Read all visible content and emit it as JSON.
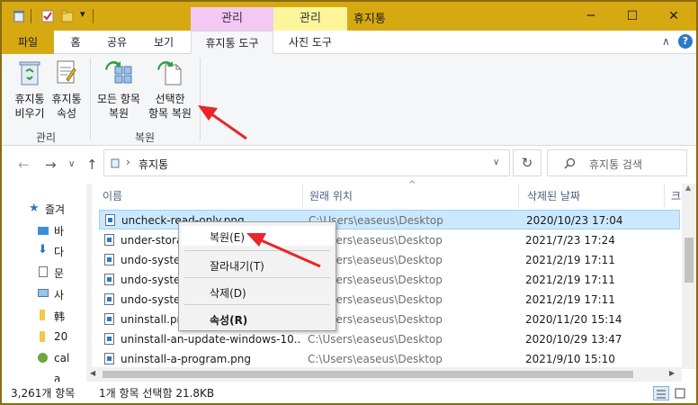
{
  "titlebar": {
    "title": "휴지통",
    "ctx_tab_manage_1": "관리",
    "ctx_tab_manage_2": "관리",
    "minimize_glyph": "─",
    "maximize_glyph": "☐",
    "close_glyph": "✕",
    "qa_dropdown_glyph": "▾"
  },
  "tabs": {
    "file": "파일",
    "home": "홈",
    "share": "공유",
    "view": "보기",
    "recycle_tools": "휴지통 도구",
    "picture_tools": "사진 도구",
    "collapse_glyph": "∧",
    "help_glyph": "?"
  },
  "ribbon": {
    "empty_bin_l1": "휴지통",
    "empty_bin_l2": "비우기",
    "props_l1": "휴지통",
    "props_l2": "속성",
    "group_manage": "관리",
    "restore_all_l1": "모든 항목",
    "restore_all_l2": "복원",
    "restore_sel_l1": "선택한",
    "restore_sel_l2": "항목 복원",
    "group_restore": "복원"
  },
  "nav": {
    "back_glyph": "←",
    "forward_glyph": "→",
    "recent_glyph": "∨",
    "up_glyph": "↑",
    "breadcrumb_sep": "›",
    "location": "휴지통",
    "addr_dropdown_glyph": "∨",
    "refresh_glyph": "↻",
    "search_placeholder": "휴지통 검색"
  },
  "navpane": {
    "items": [
      "즐겨",
      "바",
      "다",
      "문",
      "사",
      "韩",
      "20",
      "cal",
      "a"
    ]
  },
  "columns": {
    "name": "이름",
    "origin": "원래 위치",
    "deleted": "삭제된 날짜",
    "size": "크",
    "sort_glyph": "^"
  },
  "files": [
    {
      "name": "uncheck-read-only.png",
      "origin": "C:\\Users\\easeus\\Desktop",
      "deleted": "2020/10/23 17:04"
    },
    {
      "name": "under-storage-sense.png",
      "origin": "C:\\Users\\easeus\\Desktop",
      "deleted": "2021/7/23 17:24"
    },
    {
      "name": "undo-system-restore-1.png",
      "origin": "C:\\Users\\easeus\\Desktop",
      "deleted": "2021/2/19 17:11"
    },
    {
      "name": "undo-system-restore-2.png",
      "origin": "C:\\Users\\easeus\\Desktop",
      "deleted": "2021/2/19 17:11"
    },
    {
      "name": "undo-system-restore-3.png",
      "origin": "C:\\Users\\easeus\\Desktop",
      "deleted": "2021/2/19 17:11"
    },
    {
      "name": "uninstall.png",
      "origin": "C:\\Users\\easeus\\Desktop",
      "deleted": "2020/11/20 15:14"
    },
    {
      "name": "uninstall-an-update-windows-10...",
      "origin": "C:\\Users\\easeus\\Desktop",
      "deleted": "2020/10/29 13:47"
    },
    {
      "name": "uninstall-a-program.png",
      "origin": "C:\\Users\\easeus\\Desktop",
      "deleted": "2021/9/10 15:10"
    }
  ],
  "context_menu": {
    "restore": "복원(E)",
    "cut": "잘라내기(T)",
    "delete": "삭제(D)",
    "properties": "속성(R)"
  },
  "status": {
    "count": "3,261개 항목",
    "selection": "1개 항목 선택함 21.8KB"
  },
  "colors": {
    "accent": "#d6a913",
    "ctx_manage_1": "#f4c8f5",
    "ctx_manage_2": "#fdf59c",
    "selection": "#cce8ff",
    "annotation_arrow": "#e8262b"
  }
}
